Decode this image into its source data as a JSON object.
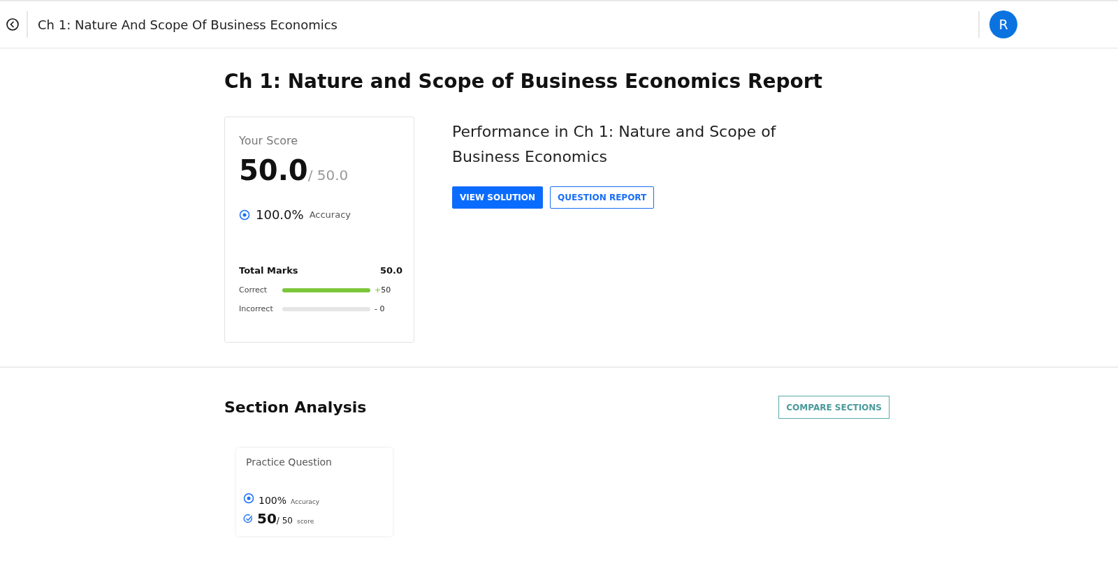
{
  "header": {
    "title": "Ch 1: Nature And Scope Of Business Economics",
    "avatar": "R"
  },
  "report": {
    "title": "Ch 1: Nature and Scope of Business Economics Report",
    "score_card": {
      "label": "Your Score",
      "score": "50.0",
      "max": "/ 50.0",
      "accuracy": "100.0%",
      "accuracy_label": "Accuracy",
      "total_label": "Total Marks",
      "total_value": "50.0",
      "rows": [
        {
          "kind": "correct",
          "label": "Correct",
          "level": 1,
          "sign": "+",
          "value": "50"
        },
        {
          "kind": "incorrect",
          "label": "Incorrect",
          "level": 0,
          "sign": "-",
          "value": " 0"
        }
      ]
    },
    "performance": "Performance in Ch 1: Nature and Scope of Business Economics",
    "buttons": [
      {
        "kind": "primary",
        "label": "VIEW SOLUTION"
      },
      {
        "kind": "outline",
        "label": "QUESTION REPORT"
      }
    ]
  },
  "section_analysis": {
    "title": "Section Analysis",
    "compare_button": "COMPARE SECTIONS",
    "sections": [
      {
        "name": "Practice Question",
        "accuracy": "100%",
        "accuracy_label": "Accuracy",
        "score": "50",
        "max": "/ 50",
        "score_label": "score"
      }
    ]
  }
}
